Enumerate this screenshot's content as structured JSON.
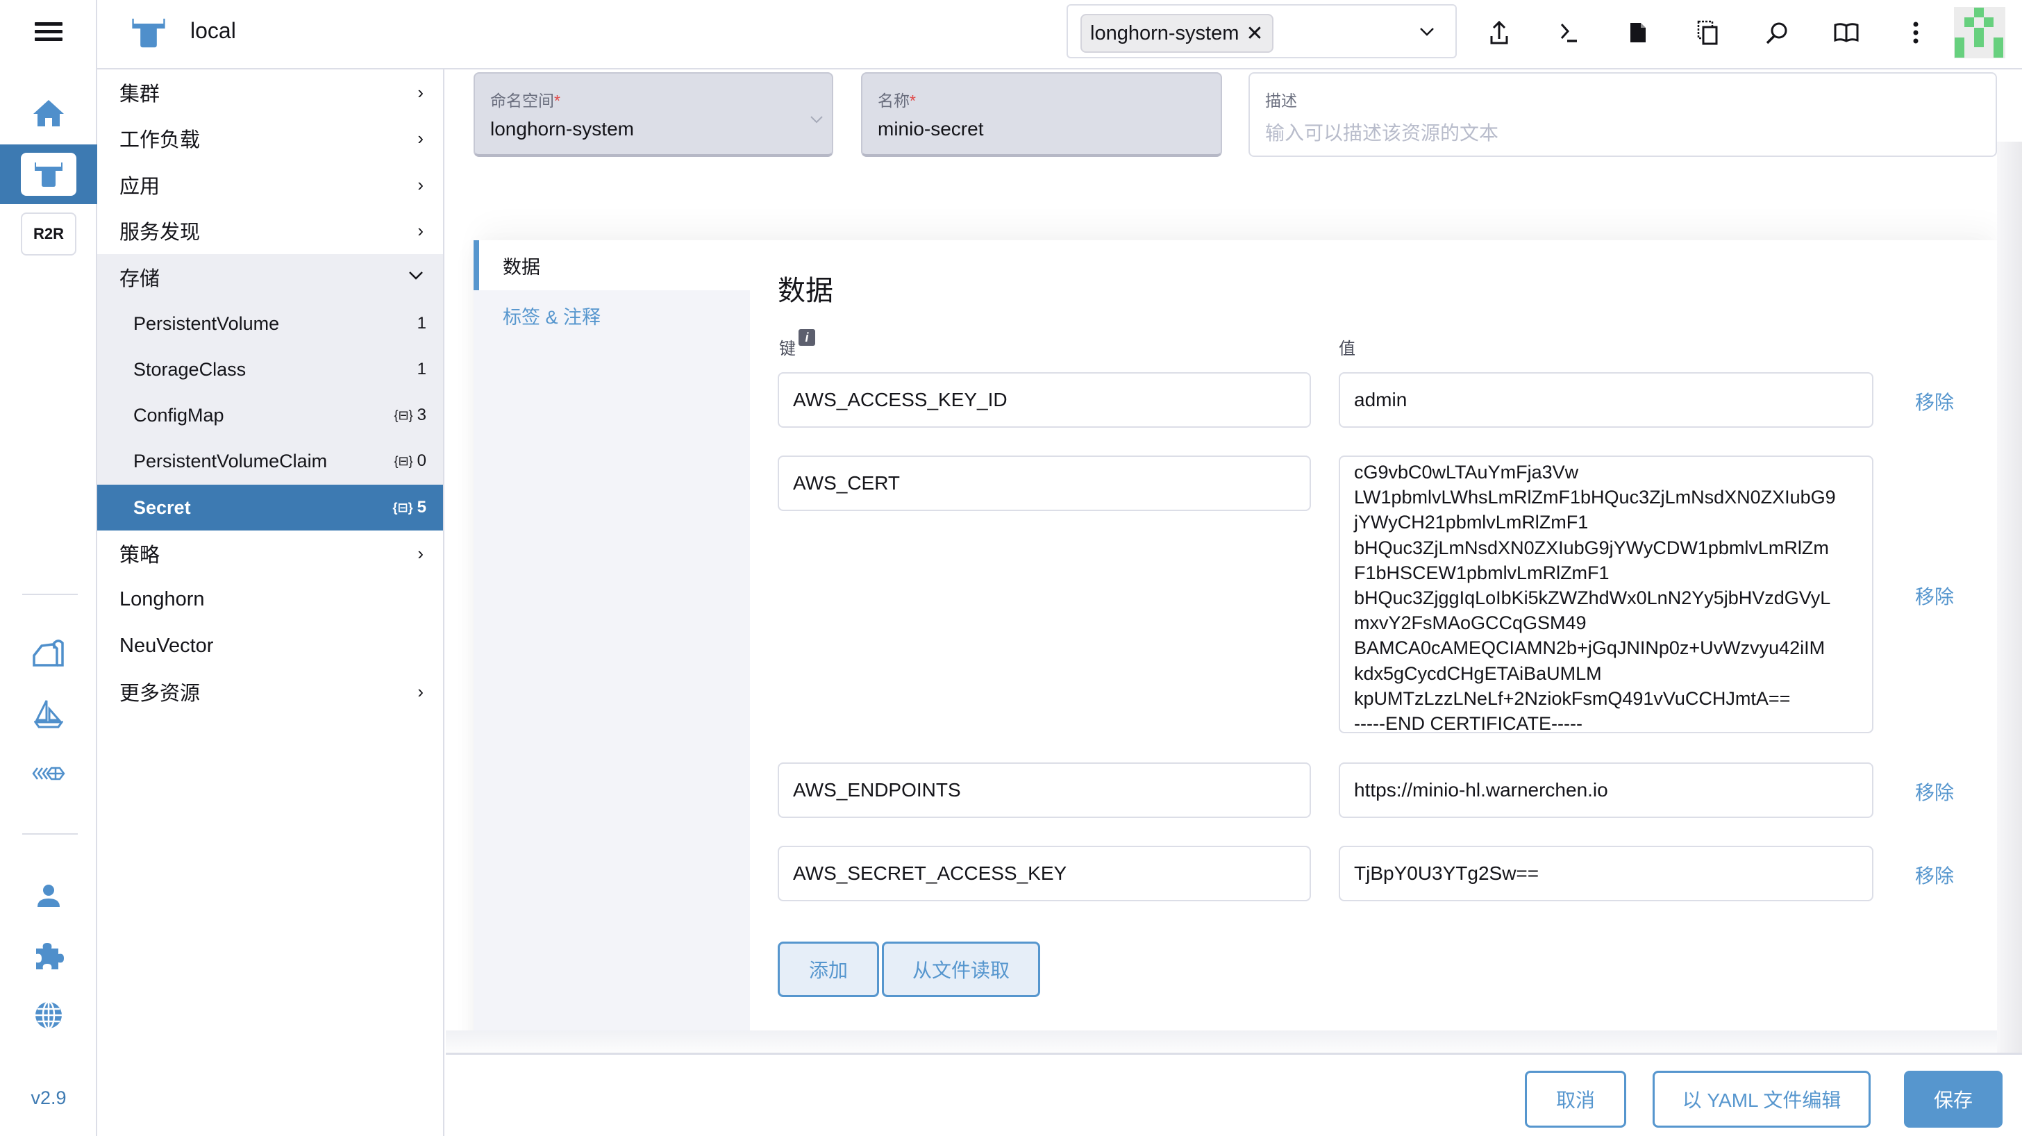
{
  "header": {
    "cluster_name": "local",
    "namespace_filter": {
      "selected_chip": "longhorn-system",
      "chip_remove_icon": "close-icon",
      "dropdown_icon": "chevron-down-icon"
    },
    "actions": [
      {
        "name": "import-yaml",
        "icon": "upload-icon"
      },
      {
        "name": "kubectl-shell",
        "icon": "terminal-icon"
      },
      {
        "name": "kubeconfig-download",
        "icon": "file-icon"
      },
      {
        "name": "copy-kubeconfig",
        "icon": "copy-icon"
      },
      {
        "name": "resource-search",
        "icon": "search-icon"
      },
      {
        "name": "docs",
        "icon": "book-icon"
      },
      {
        "name": "more-actions",
        "icon": "kebab-menu-icon"
      }
    ],
    "colors": {
      "avatar_green": "#67d07e"
    }
  },
  "rail": {
    "items": [
      {
        "name": "home",
        "icon": "home-icon"
      },
      {
        "name": "local-cluster",
        "icon": "cluster-bull-icon",
        "active": true
      },
      {
        "name": "r2r-cluster",
        "label": "R2R"
      },
      {
        "name": "longhorn",
        "icon": "longhorn-barn-icon"
      },
      {
        "name": "fleet",
        "icon": "sailboat-icon"
      },
      {
        "name": "neuvector",
        "icon": "neuvector-icon"
      },
      {
        "name": "users",
        "icon": "user-icon"
      },
      {
        "name": "extensions",
        "icon": "puzzle-icon"
      },
      {
        "name": "global-settings",
        "icon": "globe-icon"
      }
    ],
    "version": "v2.9"
  },
  "sidenav": {
    "items": [
      {
        "label": "集群",
        "expandable": true
      },
      {
        "label": "工作负载",
        "expandable": true
      },
      {
        "label": "应用",
        "expandable": true
      },
      {
        "label": "服务发现",
        "expandable": true
      },
      {
        "label": "存储",
        "expanded": true
      },
      {
        "label": "PersistentVolume",
        "count": "1",
        "child": true
      },
      {
        "label": "StorageClass",
        "count": "1",
        "child": true
      },
      {
        "label": "ConfigMap",
        "count": "3",
        "namespaced": true,
        "child": true
      },
      {
        "label": "PersistentVolumeClaim",
        "count": "0",
        "namespaced": true,
        "child": true
      },
      {
        "label": "Secret",
        "count": "5",
        "namespaced": true,
        "child": true,
        "active": true
      },
      {
        "label": "策略",
        "expandable": true
      },
      {
        "label": "Longhorn"
      },
      {
        "label": "NeuVector"
      },
      {
        "label": "更多资源",
        "expandable": true
      }
    ],
    "namespaced_icon": "{⊟}"
  },
  "form": {
    "namespace": {
      "label": "命名空间",
      "required_mark": "*",
      "value": "longhorn-system"
    },
    "name": {
      "label": "名称",
      "required_mark": "*",
      "value": "minio-secret"
    },
    "description": {
      "label": "描述",
      "placeholder": "输入可以描述该资源的文本",
      "value": ""
    }
  },
  "tabs": [
    {
      "label": "数据",
      "active": true
    },
    {
      "label": "标签 & 注释",
      "active": false
    }
  ],
  "data_section": {
    "title": "数据",
    "key_header": "键",
    "value_header": "值",
    "info_icon": "info-icon",
    "remove_label": "移除",
    "rows": [
      {
        "key": "AWS_ACCESS_KEY_ID",
        "value": "admin"
      },
      {
        "key": "AWS_CERT",
        "value": "cG9vbC0wLTAuYmFja3Vw\nLW1pbmlvLWhsLmRlZmF1bHQuc3ZjLmNsdXN0ZXIubG9\njYWyCH21pbmlvLmRlZmF1\nbHQuc3ZjLmNsdXN0ZXIubG9jYWyCDW1pbmlvLmRlZm\nF1bHSCEW1pbmlvLmRlZmF1\nbHQuc3ZjggIqLoIbKi5kZWZhdWx0LnN2Yy5jbHVzdGVyL\nmxvY2FsMAoGCCqGSM49\nBAMCA0cAMEQCIAMN2b+jGqJNINp0z+UvWzvyu42iIM\nkdx5gCycdCHgETAiBaUMLM\nkpUMTzLzzLNeLf+2NziokFsmQ491vVuCCHJmtA==\n-----END CERTIFICATE-----"
      },
      {
        "key": "AWS_ENDPOINTS",
        "value": "https://minio-hl.warnerchen.io"
      },
      {
        "key": "AWS_SECRET_ACCESS_KEY",
        "value": "TjBpY0U3YTg2Sw=="
      }
    ],
    "add_label": "添加",
    "read_file_label": "从文件读取"
  },
  "footer": {
    "cancel_label": "取消",
    "edit_yaml_label": "以 YAML 文件编辑",
    "save_label": "保存"
  },
  "colors": {
    "primary": "#5696ce",
    "active_nav": "#3d7ab2",
    "required": "#e04a4a"
  }
}
